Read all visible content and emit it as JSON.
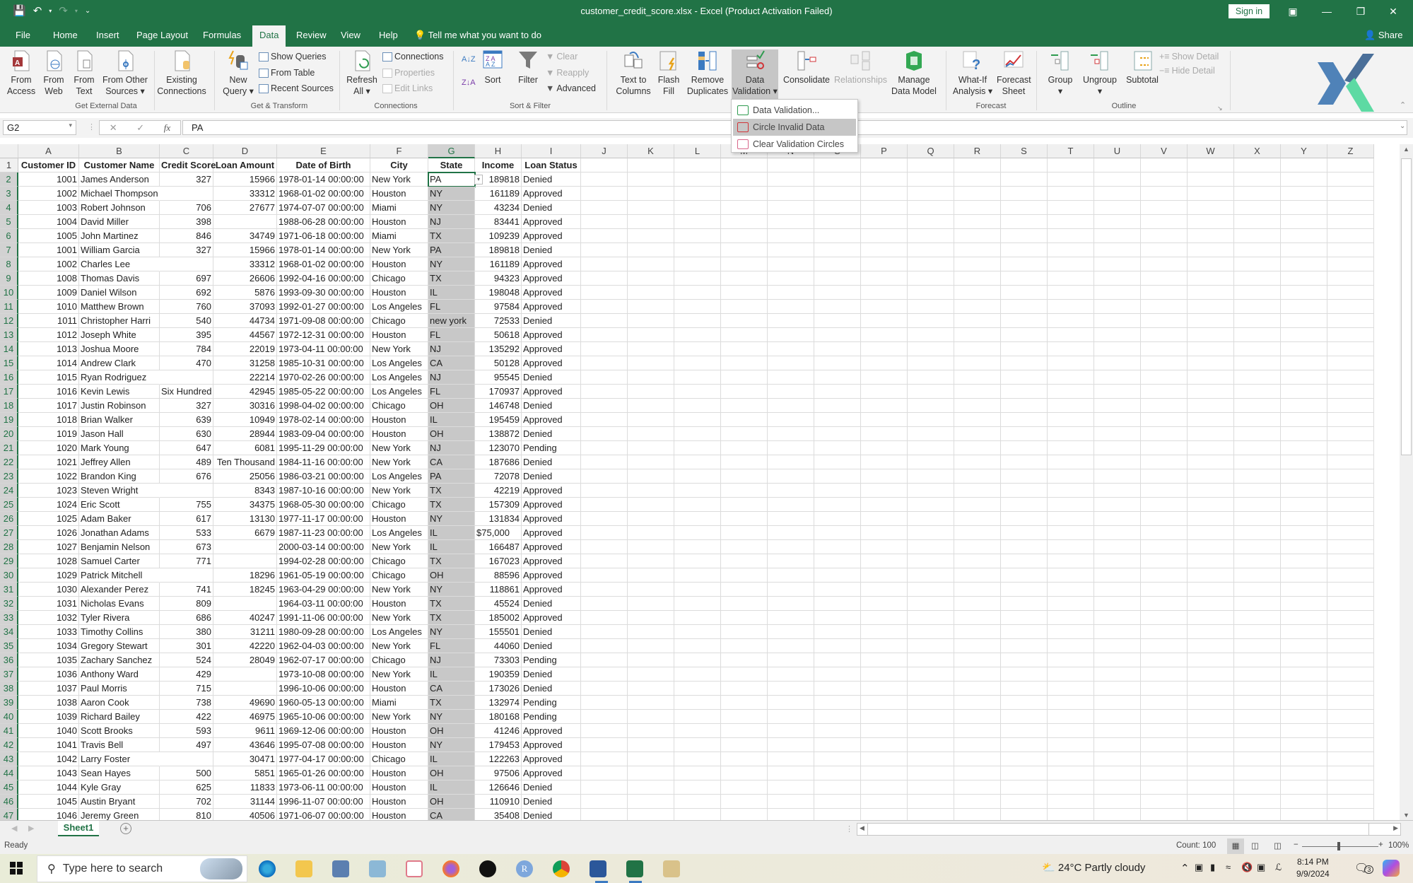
{
  "window": {
    "title": "customer_credit_score.xlsx  -  Excel (Product Activation Failed)",
    "sign_in": "Sign in",
    "share": "Share"
  },
  "menu": {
    "tabs": [
      "File",
      "Home",
      "Insert",
      "Page Layout",
      "Formulas",
      "Data",
      "Review",
      "View",
      "Help"
    ],
    "active": "Data",
    "tell_me": "Tell me what you want to do"
  },
  "ribbon": {
    "get_external": {
      "label": "Get External Data",
      "from_access": [
        "From",
        "Access"
      ],
      "from_web": [
        "From",
        "Web"
      ],
      "from_text": [
        "From",
        "Text"
      ],
      "from_other": [
        "From Other",
        "Sources ▾"
      ],
      "existing": [
        "Existing",
        "Connections"
      ]
    },
    "get_transform": {
      "label": "Get & Transform",
      "new_query": [
        "New",
        "Query ▾"
      ],
      "show_queries": "Show Queries",
      "from_table": "From Table",
      "recent_sources": "Recent Sources"
    },
    "connections": {
      "label": "Connections",
      "refresh_all": [
        "Refresh",
        "All ▾"
      ],
      "connections": "Connections",
      "properties": "Properties",
      "edit_links": "Edit Links"
    },
    "sort_filter": {
      "label": "Sort & Filter",
      "sort": "Sort",
      "filter": "Filter",
      "clear": "Clear",
      "reapply": "Reapply",
      "advanced": "Advanced"
    },
    "data_tools": {
      "text_to_columns": [
        "Text to",
        "Columns"
      ],
      "flash_fill": [
        "Flash",
        "Fill"
      ],
      "remove_duplicates": [
        "Remove",
        "Duplicates"
      ],
      "data_validation": [
        "Data",
        "Validation ▾"
      ],
      "consolidate": "Consolidate",
      "relationships": "Relationships",
      "manage_data_model": [
        "Manage",
        "Data Model"
      ]
    },
    "forecast": {
      "label": "Forecast",
      "what_if": [
        "What-If",
        "Analysis ▾"
      ],
      "forecast_sheet": [
        "Forecast",
        "Sheet"
      ]
    },
    "outline": {
      "label": "Outline",
      "group": [
        "Group",
        "▾"
      ],
      "ungroup": [
        "Ungroup",
        "▾"
      ],
      "subtotal": "Subtotal",
      "show_detail": "Show Detail",
      "hide_detail": "Hide Detail"
    }
  },
  "dv_menu": {
    "items": [
      "Data Validation...",
      "Circle Invalid Data",
      "Clear Validation Circles"
    ],
    "highlighted": "Circle Invalid Data"
  },
  "formula_bar": {
    "name_box": "G2",
    "value": "PA"
  },
  "sheet": {
    "columns": [
      "A",
      "B",
      "C",
      "D",
      "E",
      "F",
      "G",
      "H",
      "I",
      "J",
      "K",
      "L",
      "M",
      "N",
      "O",
      "P",
      "Q",
      "R",
      "S",
      "T",
      "U",
      "V",
      "W",
      "X",
      "Y",
      "Z"
    ],
    "selected_column": "G",
    "headers": [
      "Customer ID",
      "Customer Name",
      "Credit Score",
      "Loan Amount",
      "Date of Birth",
      "City",
      "State",
      "Income",
      "Loan Status"
    ],
    "rows": [
      [
        "1001",
        "James Anderson",
        "327",
        "15966",
        "1978-01-14 00:00:00",
        "New York",
        "PA",
        "189818",
        "Denied"
      ],
      [
        "1002",
        "Michael Thompson",
        "",
        "33312",
        "1968-01-02 00:00:00",
        "Houston",
        "NY",
        "161189",
        "Approved"
      ],
      [
        "1003",
        "Robert Johnson",
        "706",
        "27677",
        "1974-07-07 00:00:00",
        "Miami",
        "NY",
        "43234",
        "Denied"
      ],
      [
        "1004",
        "David Miller",
        "398",
        "",
        "1988-06-28 00:00:00",
        "Houston",
        "NJ",
        "83441",
        "Approved"
      ],
      [
        "1005",
        "John Martinez",
        "846",
        "34749",
        "1971-06-18 00:00:00",
        "Miami",
        "TX",
        "109239",
        "Approved"
      ],
      [
        "1001",
        "William Garcia",
        "327",
        "15966",
        "1978-01-14 00:00:00",
        "New York",
        "PA",
        "189818",
        "Denied"
      ],
      [
        "1002",
        "Charles Lee",
        "",
        "33312",
        "1968-01-02 00:00:00",
        "Houston",
        "NY",
        "161189",
        "Approved"
      ],
      [
        "1008",
        "Thomas Davis",
        "697",
        "26606",
        "1992-04-16 00:00:00",
        "Chicago",
        "TX",
        "94323",
        "Approved"
      ],
      [
        "1009",
        "Daniel Wilson",
        "692",
        "5876",
        "1993-09-30 00:00:00",
        "Houston",
        "IL",
        "198048",
        "Approved"
      ],
      [
        "1010",
        "Matthew Brown",
        "760",
        "37093",
        "1992-01-27 00:00:00",
        "Los Angeles",
        "FL",
        "97584",
        "Approved"
      ],
      [
        "1011",
        "Christopher Harri",
        "540",
        "44734",
        "1971-09-08 00:00:00",
        "Chicago",
        "new york",
        "72533",
        "Denied"
      ],
      [
        "1012",
        "Joseph White",
        "395",
        "44567",
        "1972-12-31 00:00:00",
        "Houston",
        "FL",
        "50618",
        "Approved"
      ],
      [
        "1013",
        "Joshua Moore",
        "784",
        "22019",
        "1973-04-11 00:00:00",
        "New York",
        "NJ",
        "135292",
        "Approved"
      ],
      [
        "1014",
        "Andrew Clark",
        "470",
        "31258",
        "1985-10-31 00:00:00",
        "Los Angeles",
        "CA",
        "50128",
        "Approved"
      ],
      [
        "1015",
        "Ryan Rodriguez",
        "",
        "22214",
        "1970-02-26 00:00:00",
        "Los Angeles",
        "NJ",
        "95545",
        "Denied"
      ],
      [
        "1016",
        "Kevin Lewis",
        "Six Hundred",
        "42945",
        "1985-05-22 00:00:00",
        "Los Angeles",
        "FL",
        "170937",
        "Approved"
      ],
      [
        "1017",
        "Justin Robinson",
        "327",
        "30316",
        "1998-04-02 00:00:00",
        "Chicago",
        "OH",
        "146748",
        "Denied"
      ],
      [
        "1018",
        "Brian Walker",
        "639",
        "10949",
        "1978-02-14 00:00:00",
        "Houston",
        "IL",
        "195459",
        "Approved"
      ],
      [
        "1019",
        "Jason Hall",
        "630",
        "28944",
        "1983-09-04 00:00:00",
        "Houston",
        "OH",
        "138872",
        "Denied"
      ],
      [
        "1020",
        "Mark Young",
        "647",
        "6081",
        "1995-11-29 00:00:00",
        "New York",
        "NJ",
        "123070",
        "Pending"
      ],
      [
        "1021",
        "Jeffrey Allen",
        "489",
        "Ten Thousand",
        "1984-11-16 00:00:00",
        "New York",
        "CA",
        "187686",
        "Denied"
      ],
      [
        "1022",
        "Brandon King",
        "676",
        "25056",
        "1986-03-21 00:00:00",
        "Los Angeles",
        "PA",
        "72078",
        "Denied"
      ],
      [
        "1023",
        "Steven Wright",
        "",
        "8343",
        "1987-10-16 00:00:00",
        "New York",
        "TX",
        "42219",
        "Approved"
      ],
      [
        "1024",
        "Eric Scott",
        "755",
        "34375",
        "1968-05-30 00:00:00",
        "Chicago",
        "TX",
        "157309",
        "Approved"
      ],
      [
        "1025",
        "Adam Baker",
        "617",
        "13130",
        "1977-11-17 00:00:00",
        "Houston",
        "NY",
        "131834",
        "Approved"
      ],
      [
        "1026",
        "Jonathan Adams",
        "533",
        "6679",
        "1987-11-23 00:00:00",
        "Los Angeles",
        "IL",
        "$75,000",
        "Approved"
      ],
      [
        "1027",
        "Benjamin Nelson",
        "673",
        "",
        "2000-03-14 00:00:00",
        "New York",
        "IL",
        "166487",
        "Approved"
      ],
      [
        "1028",
        "Samuel Carter",
        "771",
        "",
        "1994-02-28 00:00:00",
        "Chicago",
        "TX",
        "167023",
        "Approved"
      ],
      [
        "1029",
        "Patrick Mitchell",
        "",
        "18296",
        "1961-05-19 00:00:00",
        "Chicago",
        "OH",
        "88596",
        "Approved"
      ],
      [
        "1030",
        "Alexander Perez",
        "741",
        "18245",
        "1963-04-29 00:00:00",
        "New York",
        "NY",
        "118861",
        "Approved"
      ],
      [
        "1031",
        "Nicholas Evans",
        "809",
        "",
        "1964-03-11 00:00:00",
        "Houston",
        "TX",
        "45524",
        "Denied"
      ],
      [
        "1032",
        "Tyler Rivera",
        "686",
        "40247",
        "1991-11-06 00:00:00",
        "New York",
        "TX",
        "185002",
        "Approved"
      ],
      [
        "1033",
        "Timothy Collins",
        "380",
        "31211",
        "1980-09-28 00:00:00",
        "Los Angeles",
        "NY",
        "155501",
        "Denied"
      ],
      [
        "1034",
        "Gregory Stewart",
        "301",
        "42220",
        "1962-04-03 00:00:00",
        "New York",
        "FL",
        "44060",
        "Denied"
      ],
      [
        "1035",
        "Zachary Sanchez",
        "524",
        "28049",
        "1962-07-17 00:00:00",
        "Chicago",
        "NJ",
        "73303",
        "Pending"
      ],
      [
        "1036",
        "Anthony Ward",
        "429",
        "",
        "1973-10-08 00:00:00",
        "New York",
        "IL",
        "190359",
        "Denied"
      ],
      [
        "1037",
        "Paul Morris",
        "715",
        "",
        "1996-10-06 00:00:00",
        "Houston",
        "CA",
        "173026",
        "Denied"
      ],
      [
        "1038",
        "Aaron Cook",
        "738",
        "49690",
        "1960-05-13 00:00:00",
        "Miami",
        "TX",
        "132974",
        "Pending"
      ],
      [
        "1039",
        "Richard Bailey",
        "422",
        "46975",
        "1965-10-06 00:00:00",
        "New York",
        "NY",
        "180168",
        "Pending"
      ],
      [
        "1040",
        "Scott Brooks",
        "593",
        "9611",
        "1969-12-06 00:00:00",
        "Houston",
        "OH",
        "41246",
        "Approved"
      ],
      [
        "1041",
        "Travis Bell",
        "497",
        "43646",
        "1995-07-08 00:00:00",
        "Houston",
        "NY",
        "179453",
        "Approved"
      ],
      [
        "1042",
        "Larry Foster",
        "",
        "30471",
        "1977-04-17 00:00:00",
        "Chicago",
        "IL",
        "122263",
        "Approved"
      ],
      [
        "1043",
        "Sean Hayes",
        "500",
        "5851",
        "1965-01-26 00:00:00",
        "Houston",
        "OH",
        "97506",
        "Approved"
      ],
      [
        "1044",
        "Kyle Gray",
        "625",
        "11833",
        "1973-06-11 00:00:00",
        "Houston",
        "IL",
        "126646",
        "Denied"
      ],
      [
        "1045",
        "Austin Bryant",
        "702",
        "31144",
        "1996-11-07 00:00:00",
        "Houston",
        "OH",
        "110910",
        "Denied"
      ],
      [
        "1046",
        "Jeremy Green",
        "810",
        "40506",
        "1971-06-07 00:00:00",
        "Houston",
        "CA",
        "35408",
        "Denied"
      ]
    ],
    "tab": "Sheet1"
  },
  "status": {
    "ready": "Ready",
    "count": "Count: 100",
    "zoom": "100%"
  },
  "taskbar": {
    "search_placeholder": "Type here to search",
    "weather": "24°C  Partly cloudy",
    "time": "8:14 PM",
    "date": "9/9/2024",
    "notifications": "3"
  },
  "colors": {
    "excel_green": "#217346",
    "ribbon_bg": "#f3f3f3",
    "selection_gray": "#c8c8c8"
  }
}
